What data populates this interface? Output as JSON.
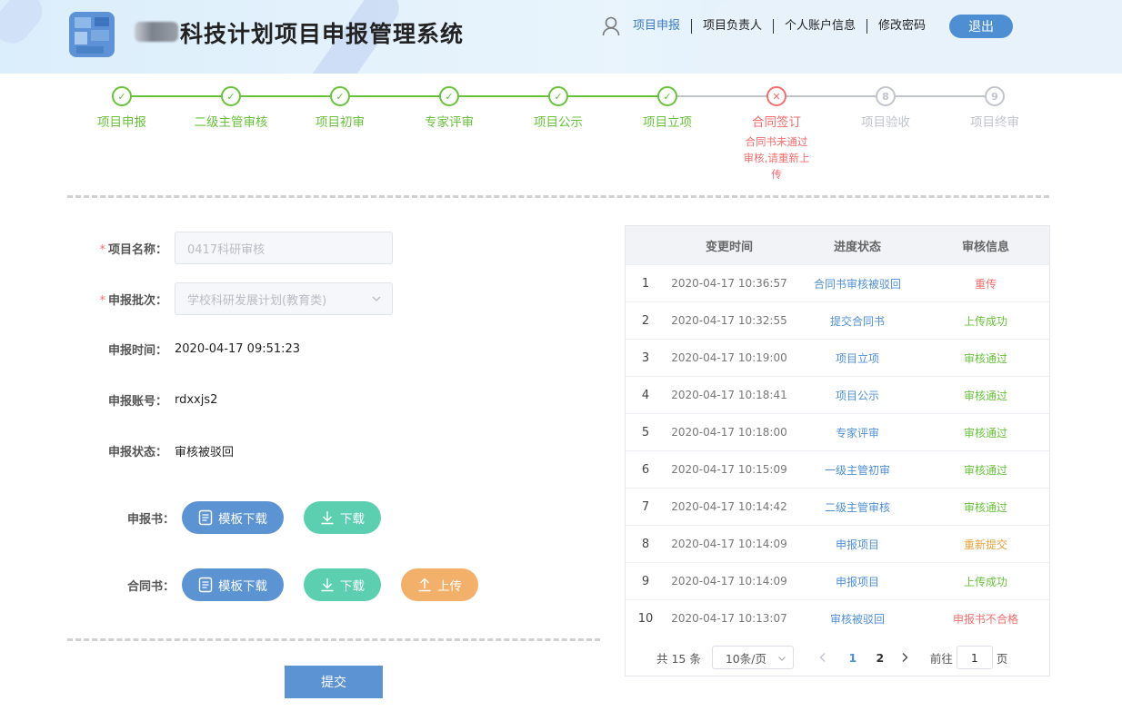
{
  "header": {
    "title": "科技计划项目申报管理系统",
    "nav": [
      {
        "label": "项目申报",
        "active": true
      },
      {
        "label": "项目负责人"
      },
      {
        "label": "个人账户信息"
      },
      {
        "label": "修改密码"
      }
    ],
    "logout_label": "退出"
  },
  "steps": [
    {
      "label": "项目申报",
      "status": "done",
      "icon": "check-icon"
    },
    {
      "label": "二级主管审核",
      "status": "done",
      "icon": "check-icon"
    },
    {
      "label": "项目初审",
      "status": "done",
      "icon": "check-icon"
    },
    {
      "label": "专家评审",
      "status": "done",
      "icon": "check-icon"
    },
    {
      "label": "项目公示",
      "status": "done",
      "icon": "check-icon"
    },
    {
      "label": "项目立项",
      "status": "done",
      "icon": "check-icon"
    },
    {
      "label": "合同签订",
      "status": "error",
      "icon": "close-icon",
      "description": "合同书未通过审核,请重新上传"
    },
    {
      "label": "项目验收",
      "status": "wait",
      "number": "8"
    },
    {
      "label": "项目终审",
      "status": "wait",
      "number": "9"
    }
  ],
  "form": {
    "project_name": {
      "label": "项目名称：",
      "required": true,
      "value": "0417科研审核"
    },
    "batch": {
      "label": "申报批次：",
      "required": true,
      "value": "学校科研发展计划(教育类)"
    },
    "apply_time": {
      "label": "申报时间：",
      "value": "2020-04-17 09:51:23"
    },
    "account": {
      "label": "申报账号：",
      "value": "rdxxjs2"
    },
    "status": {
      "label": "申报状态：",
      "value": "审核被驳回"
    },
    "application_doc": {
      "label": "申报书：",
      "template_label": "模板下载",
      "download_label": "下载"
    },
    "contract_doc": {
      "label": "合同书：",
      "template_label": "模板下载",
      "download_label": "下载",
      "upload_label": "上传"
    },
    "submit_label": "提交"
  },
  "table": {
    "columns": [
      "",
      "变更时间",
      "进度状态",
      "审核信息"
    ],
    "rows": [
      {
        "index": "1",
        "time": "2020-04-17 10:36:57",
        "progress": "合同书审核被驳回",
        "info": "重传",
        "info_color": "red"
      },
      {
        "index": "2",
        "time": "2020-04-17 10:32:55",
        "progress": "提交合同书",
        "info": "上传成功",
        "info_color": "green"
      },
      {
        "index": "3",
        "time": "2020-04-17 10:19:00",
        "progress": "项目立项",
        "info": "审核通过",
        "info_color": "green"
      },
      {
        "index": "4",
        "time": "2020-04-17 10:18:41",
        "progress": "项目公示",
        "info": "审核通过",
        "info_color": "green"
      },
      {
        "index": "5",
        "time": "2020-04-17 10:18:00",
        "progress": "专家评审",
        "info": "审核通过",
        "info_color": "green"
      },
      {
        "index": "6",
        "time": "2020-04-17 10:15:09",
        "progress": "一级主管初审",
        "info": "审核通过",
        "info_color": "green"
      },
      {
        "index": "7",
        "time": "2020-04-17 10:14:42",
        "progress": "二级主管审核",
        "info": "审核通过",
        "info_color": "green"
      },
      {
        "index": "8",
        "time": "2020-04-17 10:14:09",
        "progress": "申报项目",
        "info": "重新提交",
        "info_color": "orange"
      },
      {
        "index": "9",
        "time": "2020-04-17 10:14:09",
        "progress": "申报项目",
        "info": "上传成功",
        "info_color": "green"
      },
      {
        "index": "10",
        "time": "2020-04-17 10:13:07",
        "progress": "审核被驳回",
        "info": "申报书不合格",
        "info_color": "red"
      }
    ]
  },
  "pagination": {
    "total": "共 15 条",
    "page_size": "10条/页",
    "pages": [
      "1",
      "2"
    ],
    "current": "1",
    "goto_label": "前往",
    "goto_value": "1",
    "page_unit": "页"
  },
  "colors": {
    "success": "#67c23a",
    "error": "#f56c6c",
    "pending": "#c0c4cc",
    "primary": "#5b93d3",
    "teal": "#5ccfb1",
    "orange": "#f3b06a"
  }
}
